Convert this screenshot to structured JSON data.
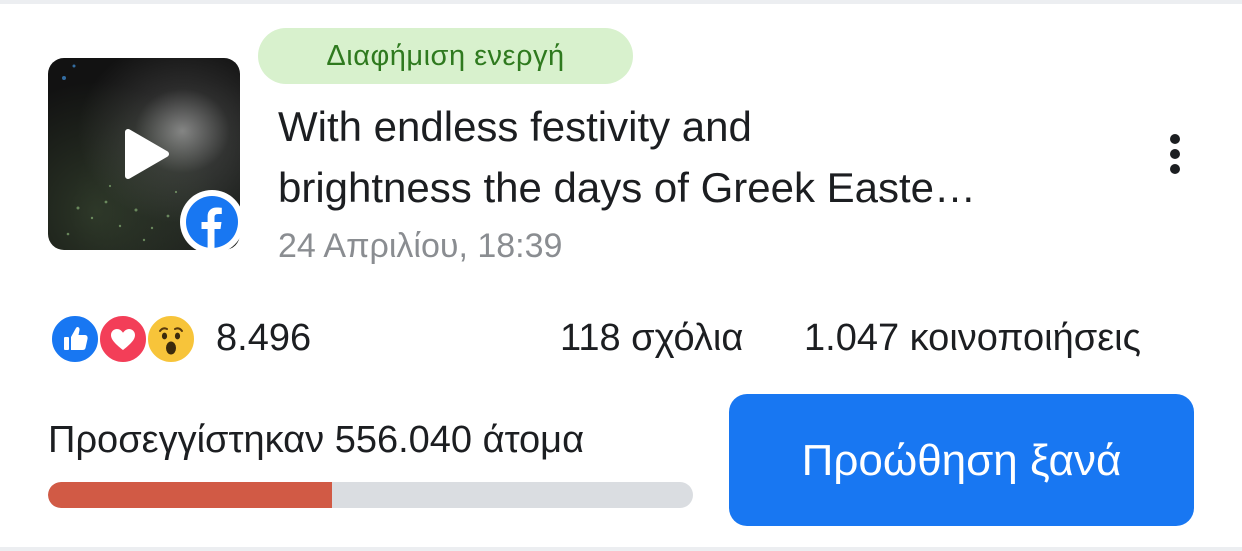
{
  "status": {
    "label": "Διαφήμιση ενεργή",
    "color": "#2f7a1f"
  },
  "post": {
    "title_line1": "With endless festivity and",
    "title_line2": "brightness the days of Greek Easte…",
    "date": "24 Απριλίου, 18:39",
    "thumbnail_icon": "play-icon",
    "source_icon": "facebook-icon"
  },
  "menu": {
    "icon": "more-vertical-icon"
  },
  "engagement": {
    "reaction_icons": [
      "like-icon",
      "love-icon",
      "wow-icon"
    ],
    "reactions": "8.496",
    "comments": "118 σχόλια",
    "shares": "1.047 κοινοποιήσεις"
  },
  "reach": {
    "label": "Προσεγγίστηκαν 556.040 άτομα",
    "progress_fraction": 0.44,
    "progress_color": "#d15a45"
  },
  "cta": {
    "label": "Προώθηση ξανά",
    "color": "#1877f2"
  }
}
